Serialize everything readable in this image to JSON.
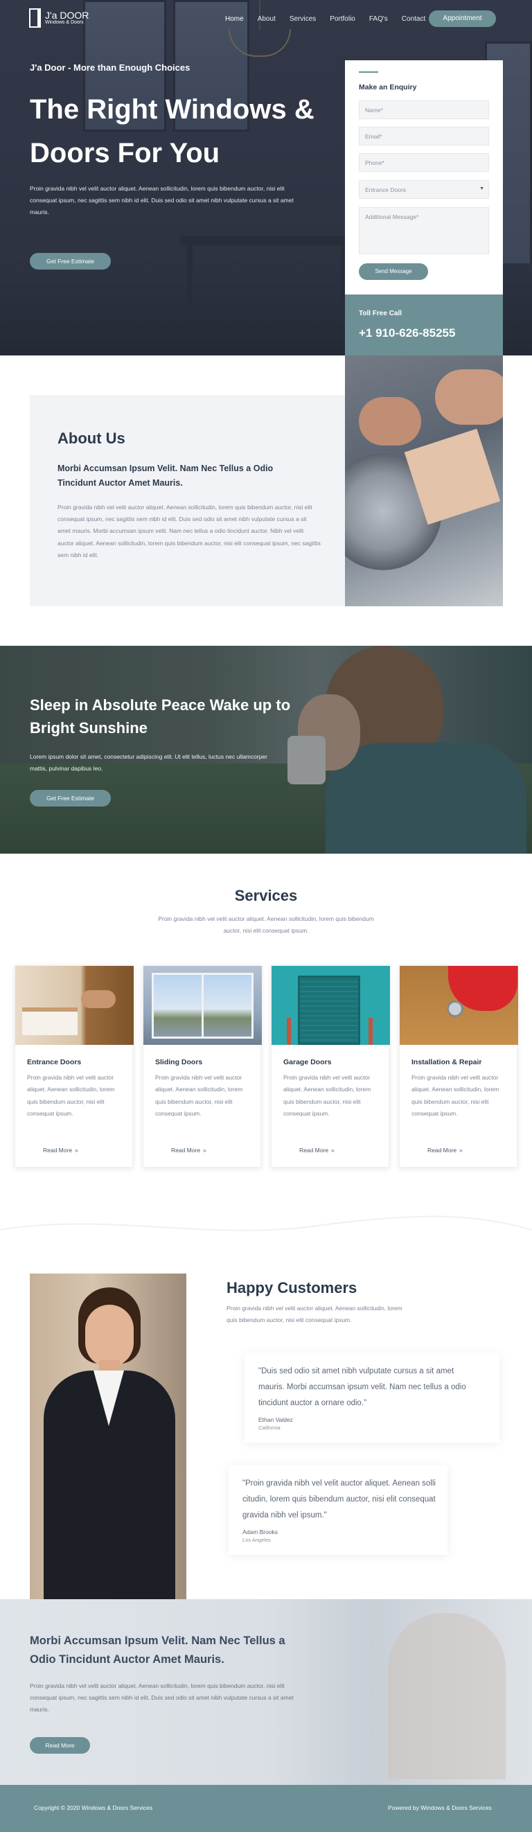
{
  "brand": {
    "name": "J'a DOOR",
    "tagline": "Windows & Doors"
  },
  "nav": {
    "items": [
      "Home",
      "About",
      "Services",
      "Portfolio",
      "FAQ's",
      "Contact"
    ],
    "cta": "Appointment"
  },
  "hero": {
    "kicker": "J'a Door - More than Enough Choices",
    "title": "The Right Windows & Doors For You",
    "text": "Proin gravida nibh vel velit auctor aliquet. Aenean sollicitudin, lorem quis bibendum auctor, nisi elit consequat ipsum, nec sagittis sem nibh id elit. Duis sed odio sit amet nibh vulputate cursus a sit amet mauris.",
    "button": "Get Free Estimate"
  },
  "enquiry": {
    "title": "Make an Enquiry",
    "name_placeholder": "Name*",
    "email_placeholder": "Email*",
    "phone_placeholder": "Phone*",
    "select_value": "Entrance Doors",
    "message_placeholder": "Additional Message*",
    "send": "Send Message"
  },
  "tollfree": {
    "label": "Toll Free Call",
    "number": "+1 910-626-85255"
  },
  "about": {
    "title": "About Us",
    "subtitle": "Morbi Accumsan Ipsum Velit. Nam Nec Tellus a Odio Tincidunt Auctor Amet Mauris.",
    "text": "Proin gravida nibh vel velit auctor aliquet. Aenean sollicitudin, lorem quis bibendum auctor, nisi elit consequat ipsum, nec sagittis sem nibh id elit. Duis sed odio sit amet nibh vulputate cursus a sit amet mauris. Morbi accumsan ipsum velit. Nam nec tellus a odio tincidunt auctor. Nibh vel velit auctor aliquet. Aenean sollicitudin, lorem quis bibendum auctor, nisi elit consequat ipsum, nec sagittis sem nibh id elit."
  },
  "sleep": {
    "title": "Sleep in Absolute Peace Wake up to Bright Sunshine",
    "text": "Lorem ipsum dolor sit amet, consectetur adipiscing elit. Ut elit tellus, luctus nec ullamcorper mattis, pulvinar dapibus leo.",
    "button": "Get Free Estimate"
  },
  "services": {
    "title": "Services",
    "text": "Proin gravida nibh vel velit auctor aliquet. Aenean sollicitudin, lorem quis bibendum auctor, nisi elit consequat ipsum.",
    "cards": [
      {
        "title": "Entrance Doors",
        "text": "Proin gravida nibh vel velit auctor aliquet. Aenean sollicitudin, lorem quis bibendum auctor, nisi elit consequat ipsum.",
        "more": "Read More"
      },
      {
        "title": "Sliding Doors",
        "text": "Proin gravida nibh vel velit auctor aliquet. Aenean sollicitudin, lorem quis bibendum auctor, nisi elit consequat ipsum.",
        "more": "Read More"
      },
      {
        "title": "Garage Doors",
        "text": "Proin gravida nibh vel velit auctor aliquet. Aenean sollicitudin, lorem quis bibendum auctor, nisi elit consequat ipsum.",
        "more": "Read More"
      },
      {
        "title": "Installation & Repair",
        "text": "Proin gravida nibh vel velit auctor aliquet. Aenean sollicitudin, lorem quis bibendum auctor, nisi elit consequat ipsum.",
        "more": "Read More"
      }
    ]
  },
  "customers": {
    "title": "Happy Customers",
    "text": "Proin gravida nibh vel velit auctor aliquet. Aenean sollicitudin, lorem quis bibendum auctor, nisi elit consequat ipsum.",
    "quotes": [
      {
        "text": "\"Duis sed odio sit amet nibh vulputate cursus a sit amet mauris. Morbi accumsan ipsum velit. Nam nec tellus a odio tincidunt auctor a ornare odio.\"",
        "name": "Ethan Valdez",
        "location": "California"
      },
      {
        "text": "\"Proin gravida nibh vel velit auctor aliquet. Aenean solli citudin, lorem quis bibendum auctor, nisi elit consequat gravida nibh vel ipsum.\"",
        "name": "Adam Brooks",
        "location": "Los Angeles"
      }
    ]
  },
  "banner": {
    "title": "Morbi Accumsan Ipsum Velit. Nam Nec Tellus a Odio Tincidunt Auctor Amet Mauris.",
    "text": "Proin gravida nibh vel velit auctor aliquet. Aenean sollicitudin, lorem quis bibendum auctor, nisi elit consequat ipsum, nec sagittis sem nibh id elit. Duis sed odio sit amet nibh vulputate cursus a sit amet mauris.",
    "button": "Read More"
  },
  "footer": {
    "copyright": "Copyright © 2020 Windows & Doors Services",
    "powered": "Powered by Windows & Doors Services"
  },
  "colors": {
    "accent": "#6c9096",
    "dark_text": "#2c3a4c",
    "muted_text": "#7a8494"
  }
}
